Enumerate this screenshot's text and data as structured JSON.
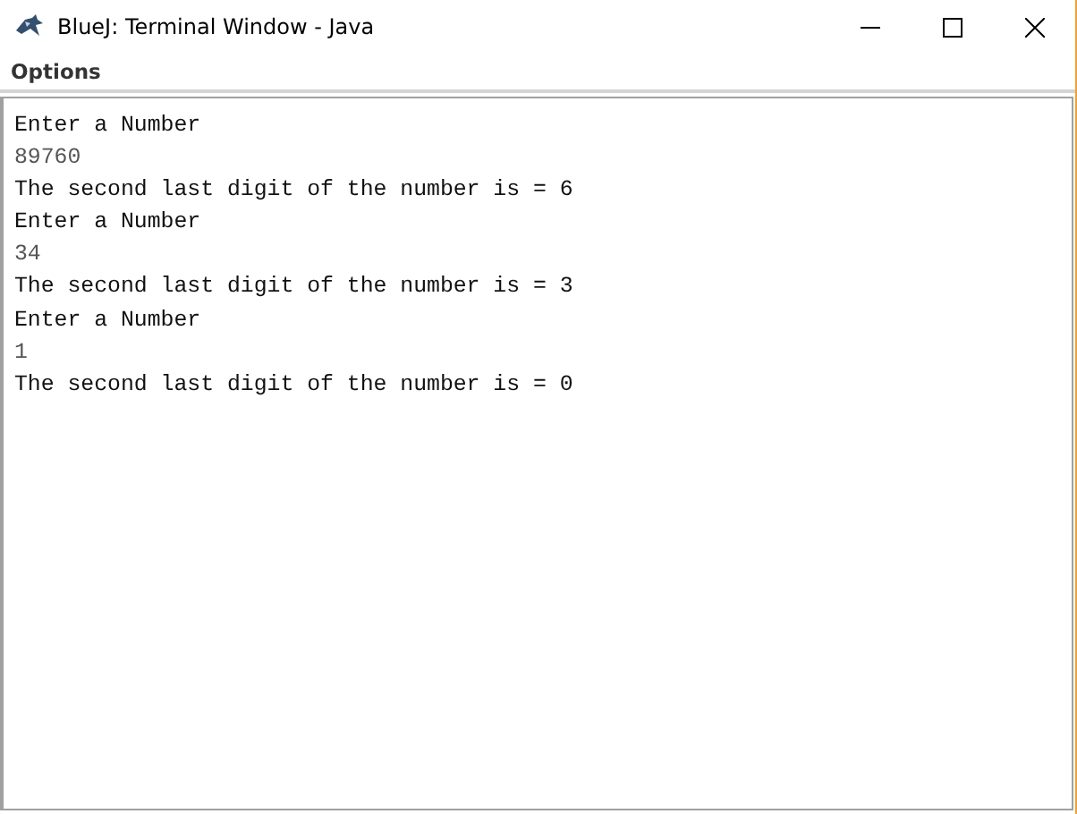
{
  "window": {
    "title": "BlueJ: Terminal Window - Java"
  },
  "menu": [
    "Options"
  ],
  "terminal": {
    "lines": [
      {
        "kind": "output",
        "text": "Enter a Number"
      },
      {
        "kind": "input",
        "text": "89760"
      },
      {
        "kind": "output",
        "text": "The second last digit of the number is = 6"
      },
      {
        "kind": "output",
        "text": "Enter a Number"
      },
      {
        "kind": "input",
        "text": "34"
      },
      {
        "kind": "output",
        "text": "The second last digit of the number is = 3"
      },
      {
        "kind": "output",
        "text": "Enter a Number"
      },
      {
        "kind": "input",
        "text": "1"
      },
      {
        "kind": "output",
        "text": "The second last digit of the number is = 0"
      }
    ]
  }
}
